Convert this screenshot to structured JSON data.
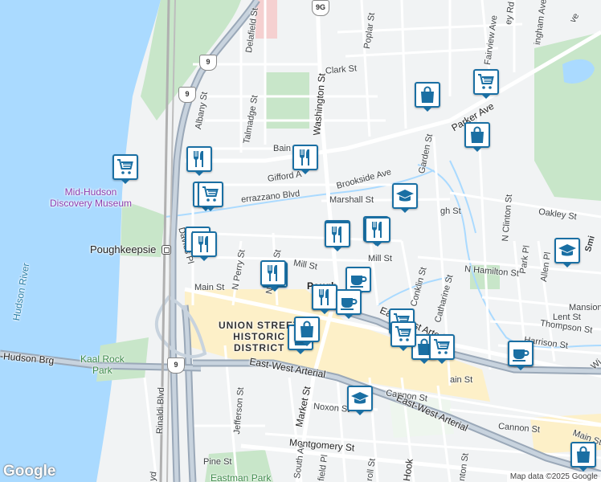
{
  "map": {
    "water_color": "#aadaff",
    "park_color": "#c8e6c9",
    "district_color": "#fdf0c8",
    "marker_color": "#1a6fa3"
  },
  "labels": {
    "route_9": "9",
    "route_9g": "9G",
    "poplar_st": "Poplar St",
    "delafield_st": "Delafield St",
    "clark_st": "Clark St",
    "washington_st": "Washington St",
    "fairview_ave": "Fairview Ave",
    "talmadge_st": "Talmadge St",
    "albany_st": "Albany St",
    "bain_ave": "Bain Ave",
    "parker_ave": "Parker Ave",
    "gifford_ave": "Gifford A",
    "brookside_ave": "Brookside Ave",
    "garden_st": "Garden St",
    "verrazzano_blvd": "errazzano Blvd",
    "marshall_st": "Marshall St",
    "mid_hudson_museum": "Mid-Hudson\nDiscovery Museum",
    "oakley_st": "Oakley St",
    "n_clinton_st": "N Clinton St",
    "davies_pl": "Davies Pl",
    "poughkeepsie": "Poughkeepsie",
    "n_perry_st": "N Perry St",
    "mill_st": "Mill St",
    "n_bridge_st": "N Bridge St",
    "n_hamilton_st": "N Hamilton St",
    "park_pl": "Park Pl",
    "allen_pl": "Allen Pl",
    "main_st": "Main St",
    "pough_partial": "Pough",
    "conklin_st": "Conklin St",
    "catharine_st": "Catharine St",
    "east_west_arterial": "East-West Arterial",
    "mansion_st": "Mansion",
    "lent_st": "Lent St",
    "thompson_st": "Thompson St",
    "hudson_river": "Hudson River",
    "union_street_district": "UNION STREET\nHISTORIC\nDISTRICT",
    "harrison_st": "Harrison St",
    "mid_hudson_brg": "-Hudson Brg",
    "kaal_rock_park": "Kaal Rock\nPark",
    "cannon_st": "Cannon St",
    "rinaldi_blvd": "Rinaldi Blvd",
    "jefferson_st": "Jefferson St",
    "market_st": "Market St",
    "noxon_st": "Noxon St",
    "montgomery_st": "Montgomery St",
    "pine_st": "Pine St",
    "south_ave": "South Av",
    "eastman_park": "Eastman Park",
    "hook_partial": "Hook",
    "yd_partial": "yd",
    "smith_partial": "Smi",
    "wi_partial": "Wi",
    "main_st_right": "Main St",
    "ingham_partial": "ingham Ave",
    "ey_rd": "ey Rd",
    "ve_partial": "ve",
    "field_pl": "field Pl",
    "roll_st": "roll St",
    "nton_st": "nton St",
    "gh_st": "gh St",
    "ain_st": "ain St"
  },
  "markers": [
    {
      "type": "shopping-cart"
    },
    {
      "type": "restaurant"
    },
    {
      "type": "shopping-cart"
    },
    {
      "type": "shopping-bag"
    },
    {
      "type": "shopping-cart"
    },
    {
      "type": "shopping-bag"
    },
    {
      "type": "restaurant"
    },
    {
      "type": "restaurant"
    },
    {
      "type": "restaurant"
    },
    {
      "type": "shopping-cart"
    },
    {
      "type": "shopping-cart"
    },
    {
      "type": "restaurant"
    },
    {
      "type": "school"
    },
    {
      "type": "restaurant"
    },
    {
      "type": "restaurant"
    },
    {
      "type": "restaurant"
    },
    {
      "type": "school"
    },
    {
      "type": "restaurant"
    },
    {
      "type": "restaurant"
    },
    {
      "type": "cafe"
    },
    {
      "type": "restaurant"
    },
    {
      "type": "cafe"
    },
    {
      "type": "cafe"
    },
    {
      "type": "shopping-bag"
    },
    {
      "type": "shopping-bag"
    },
    {
      "type": "shopping-cart"
    },
    {
      "type": "shopping-cart"
    },
    {
      "type": "shopping-bag"
    },
    {
      "type": "shopping-cart"
    },
    {
      "type": "cafe"
    },
    {
      "type": "school"
    },
    {
      "type": "shopping-bag"
    }
  ],
  "logo": "Google",
  "attribution": "Map data ©2025 Google"
}
